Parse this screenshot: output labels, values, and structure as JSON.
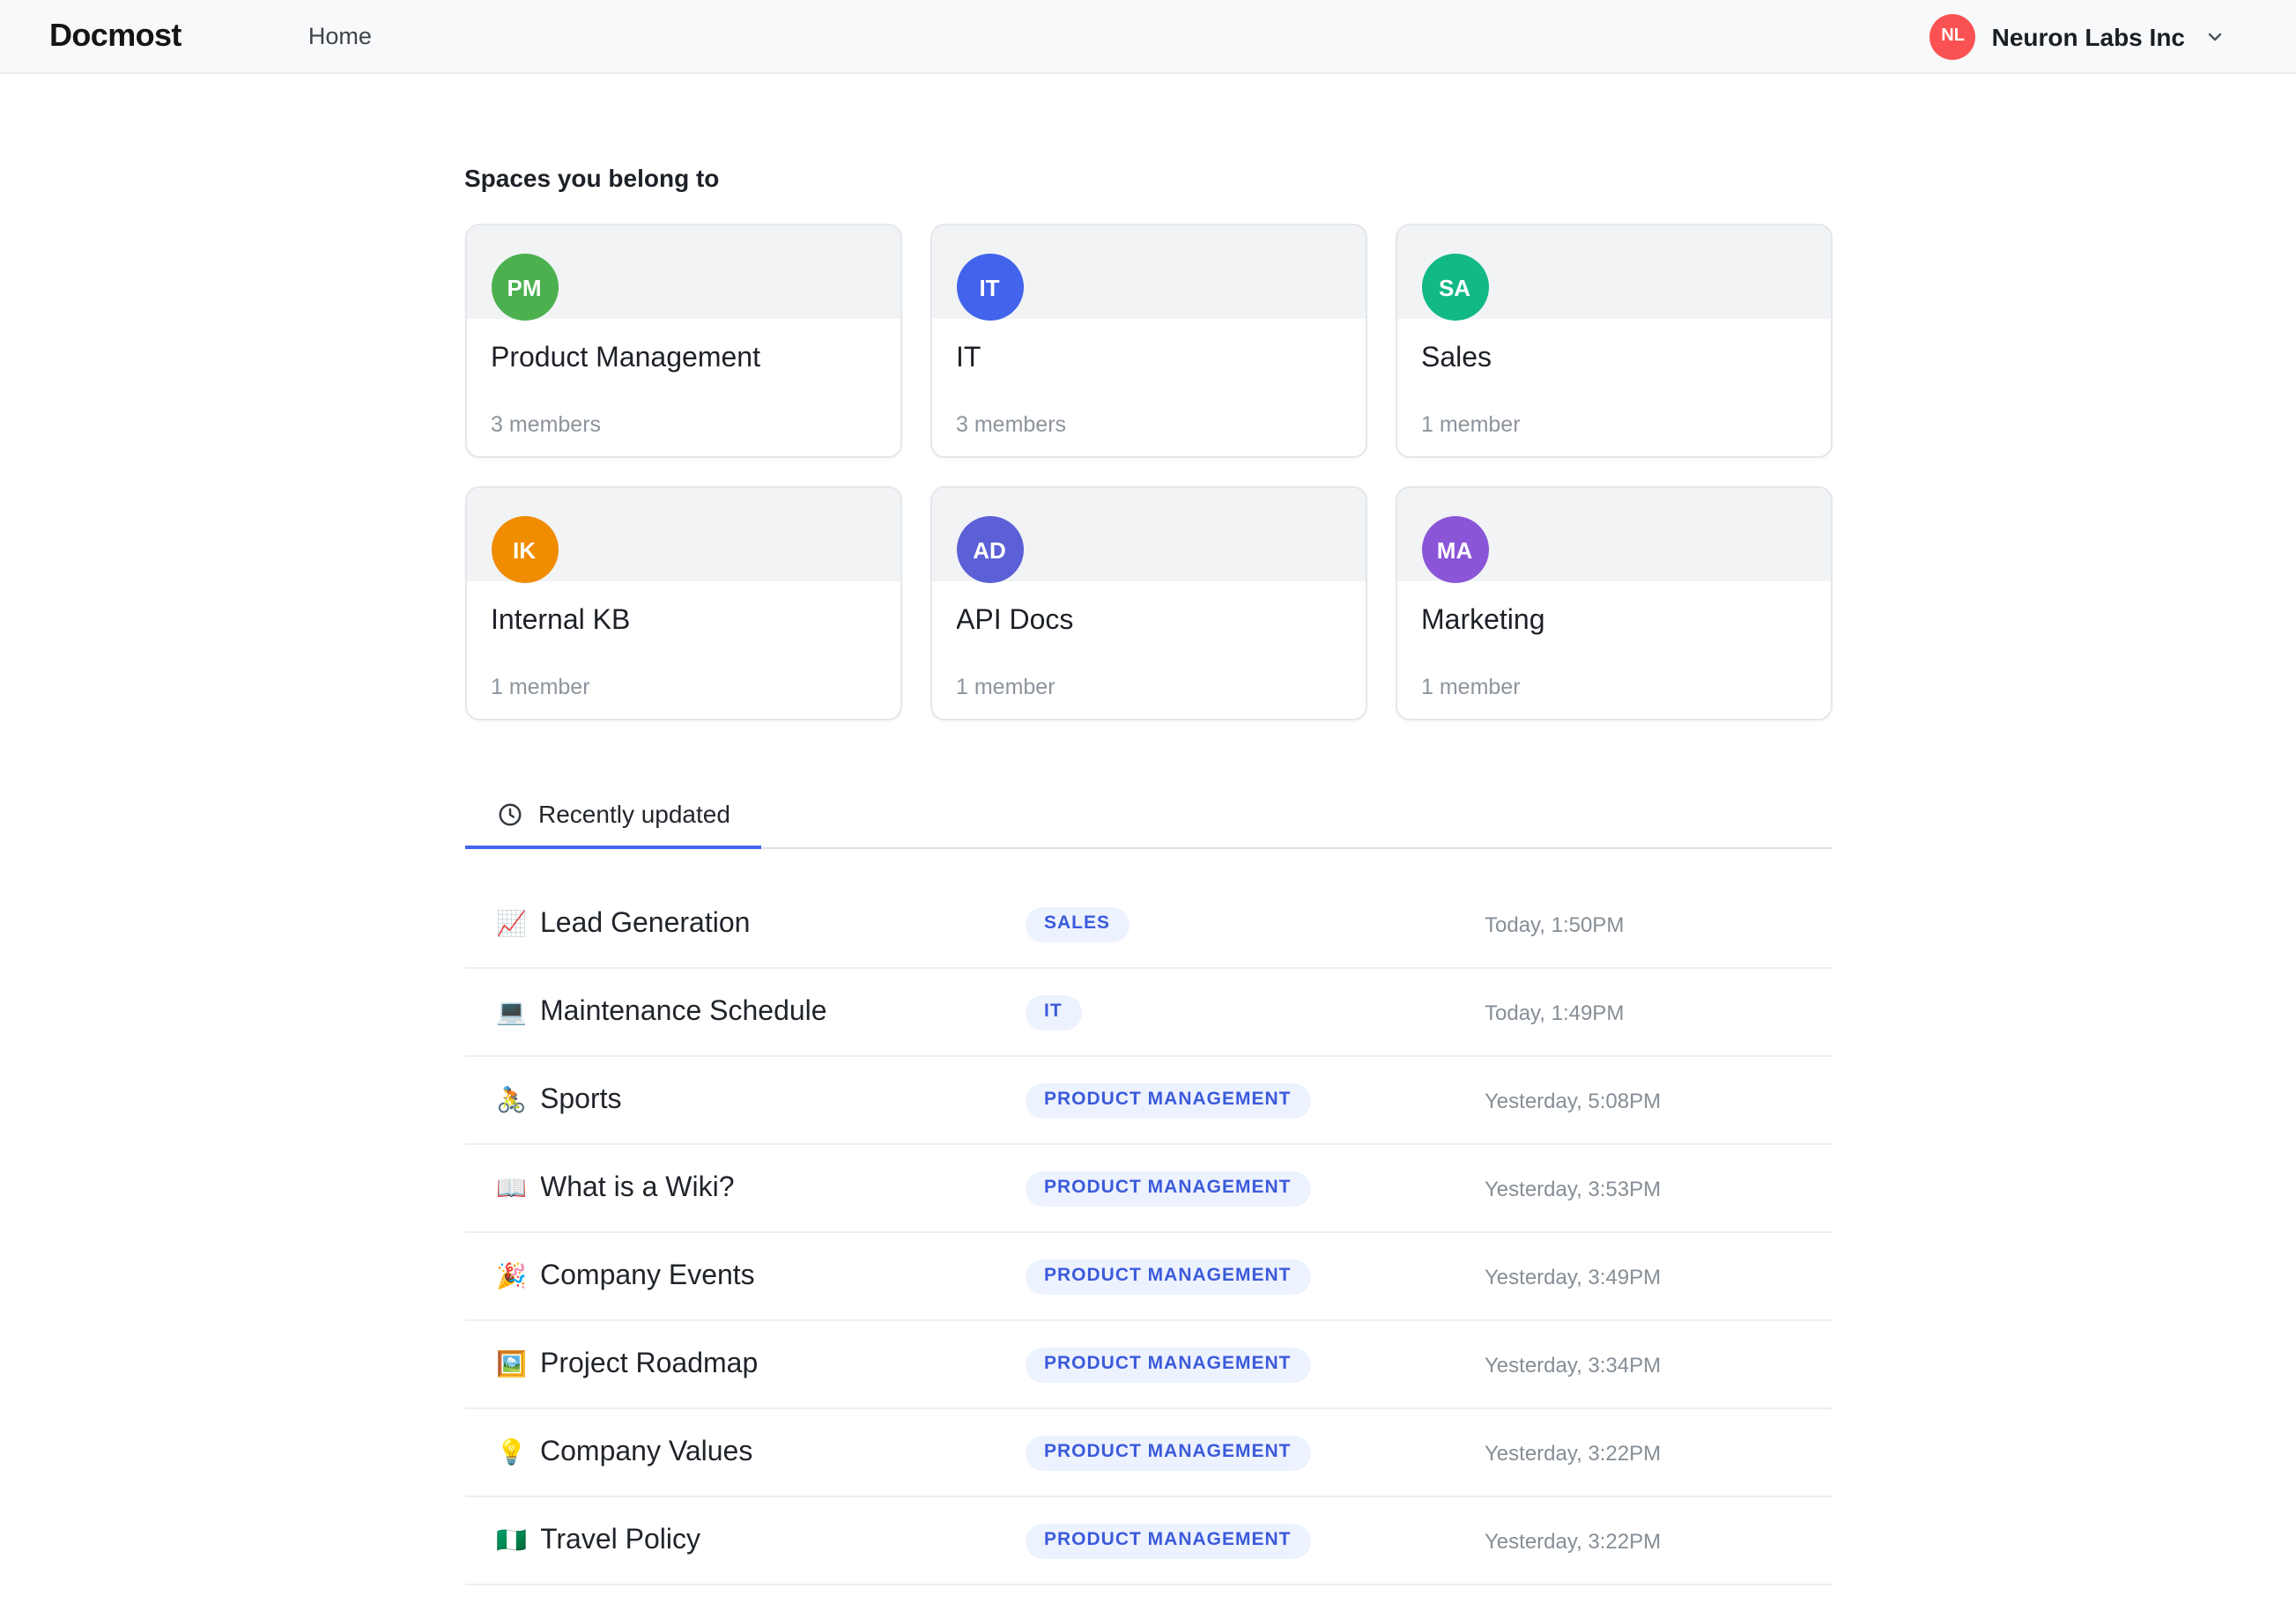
{
  "header": {
    "logo": "Docmost",
    "nav_home": "Home",
    "workspace": {
      "initials": "NL",
      "name": "Neuron Labs Inc"
    },
    "workspace_avatar_color": "#fa5252"
  },
  "spaces": {
    "heading": "Spaces you belong to",
    "cards": [
      {
        "initials": "PM",
        "name": "Product Management",
        "members": "3 members",
        "color": "#4cb04f"
      },
      {
        "initials": "IT",
        "name": "IT",
        "members": "3 members",
        "color": "#4263eb"
      },
      {
        "initials": "SA",
        "name": "Sales",
        "members": "1 member",
        "color": "#12b886"
      },
      {
        "initials": "IK",
        "name": "Internal KB",
        "members": "1 member",
        "color": "#f08c00"
      },
      {
        "initials": "AD",
        "name": "API Docs",
        "members": "1 member",
        "color": "#5c60d6"
      },
      {
        "initials": "MA",
        "name": "Marketing",
        "members": "1 member",
        "color": "#8a55d7"
      }
    ]
  },
  "recent": {
    "tab_label": "Recently updated",
    "items": [
      {
        "icon": "📈",
        "icon_name": "chart-increasing-icon",
        "title": "Lead Generation",
        "badge": "SALES",
        "time": "Today, 1:50PM"
      },
      {
        "icon": "💻",
        "icon_name": "laptop-icon",
        "title": "Maintenance Schedule",
        "badge": "IT",
        "time": "Today, 1:49PM"
      },
      {
        "icon": "🚴",
        "icon_name": "cyclist-icon",
        "title": "Sports",
        "badge": "PRODUCT MANAGEMENT",
        "time": "Yesterday, 5:08PM"
      },
      {
        "icon": "📖",
        "icon_name": "open-book-icon",
        "title": "What is a Wiki?",
        "badge": "PRODUCT MANAGEMENT",
        "time": "Yesterday, 3:53PM"
      },
      {
        "icon": "🎉",
        "icon_name": "party-popper-icon",
        "title": "Company Events",
        "badge": "PRODUCT MANAGEMENT",
        "time": "Yesterday, 3:49PM"
      },
      {
        "icon": "🖼️",
        "icon_name": "framed-picture-icon",
        "title": "Project Roadmap",
        "badge": "PRODUCT MANAGEMENT",
        "time": "Yesterday, 3:34PM"
      },
      {
        "icon": "💡",
        "icon_name": "light-bulb-icon",
        "title": "Company Values",
        "badge": "PRODUCT MANAGEMENT",
        "time": "Yesterday, 3:22PM"
      },
      {
        "icon": "🇳🇬",
        "icon_name": "nigeria-flag-icon",
        "title": "Travel Policy",
        "badge": "PRODUCT MANAGEMENT",
        "time": "Yesterday, 3:22PM"
      }
    ]
  },
  "colors": {
    "accent": "#4263eb",
    "badge_bg": "#edf2ff",
    "badge_text": "#3b5bdb",
    "header_bg": "#f8f9fa",
    "card_band": "#f1f3f5",
    "workspace_avatar": "#fa5252"
  }
}
